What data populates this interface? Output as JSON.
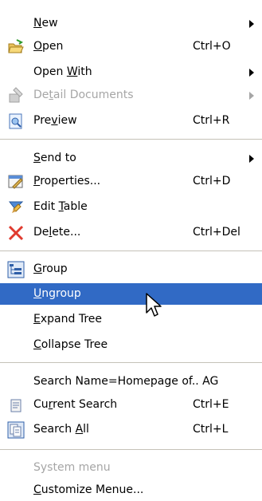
{
  "menu": {
    "items": [
      {
        "label": "New",
        "mnemonic": "N",
        "shortcut": "",
        "submenu": true,
        "disabled": false,
        "icon": "none"
      },
      {
        "label": "Open",
        "mnemonic": "O",
        "shortcut": "Ctrl+O",
        "submenu": false,
        "disabled": false,
        "icon": "open-folder-icon"
      },
      {
        "label": "Open With",
        "mnemonic": "W",
        "shortcut": "",
        "submenu": true,
        "disabled": false,
        "icon": "none"
      },
      {
        "label": "Detail Documents",
        "mnemonic": "t",
        "shortcut": "",
        "submenu": true,
        "disabled": true,
        "icon": "detail-documents-icon"
      },
      {
        "label": "Preview",
        "mnemonic": "v",
        "shortcut": "Ctrl+R",
        "submenu": false,
        "disabled": false,
        "icon": "preview-icon"
      },
      {
        "label": "Send to",
        "mnemonic": "S",
        "shortcut": "",
        "submenu": true,
        "disabled": false,
        "icon": "none"
      },
      {
        "label": "Properties...",
        "mnemonic": "P",
        "shortcut": "Ctrl+D",
        "submenu": false,
        "disabled": false,
        "icon": "properties-icon"
      },
      {
        "label": "Edit Table",
        "mnemonic": "T",
        "shortcut": "",
        "submenu": false,
        "disabled": false,
        "icon": "edit-table-icon"
      },
      {
        "label": "Delete...",
        "mnemonic": "l",
        "shortcut": "Ctrl+Del",
        "submenu": false,
        "disabled": false,
        "icon": "delete-icon"
      },
      {
        "label": "Group",
        "mnemonic": "G",
        "shortcut": "",
        "submenu": false,
        "disabled": false,
        "icon": "group-icon"
      },
      {
        "label": "Ungroup",
        "mnemonic": "U",
        "shortcut": "",
        "submenu": false,
        "disabled": false,
        "icon": "none",
        "highlighted": true
      },
      {
        "label": "Expand Tree",
        "mnemonic": "E",
        "shortcut": "",
        "submenu": false,
        "disabled": false,
        "icon": "none"
      },
      {
        "label": "Collapse Tree",
        "mnemonic": "C",
        "shortcut": "",
        "submenu": false,
        "disabled": false,
        "icon": "none"
      },
      {
        "label": "Search Name=Homepage of.. AG",
        "mnemonic": "",
        "shortcut": "",
        "submenu": false,
        "disabled": false,
        "icon": "none"
      },
      {
        "label": "Current Search",
        "mnemonic": "r",
        "shortcut": "Ctrl+E",
        "submenu": false,
        "disabled": false,
        "icon": "current-search-icon"
      },
      {
        "label": "Search All",
        "mnemonic": "A",
        "shortcut": "Ctrl+L",
        "submenu": false,
        "disabled": false,
        "icon": "search-all-icon"
      },
      {
        "label": "System menu",
        "mnemonic": "",
        "shortcut": "",
        "submenu": false,
        "disabled": true,
        "icon": "none"
      },
      {
        "label": "Customize Menue...",
        "mnemonic": "C",
        "shortcut": "",
        "submenu": false,
        "disabled": false,
        "icon": "none"
      }
    ]
  },
  "colors": {
    "highlight": "#316ac5",
    "disabled": "#a6a6a6",
    "separator": "#c5c2b8"
  }
}
